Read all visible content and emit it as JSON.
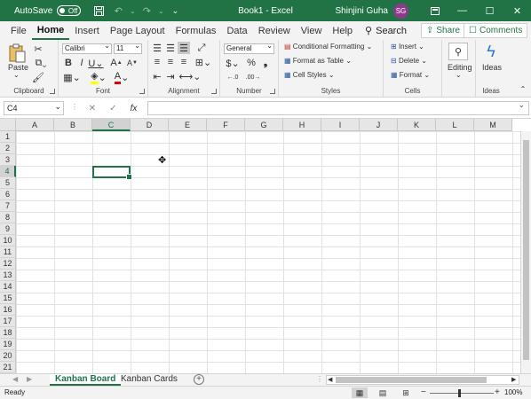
{
  "titlebar": {
    "autosave_label": "AutoSave",
    "autosave_state": "Off",
    "title": "Book1 - Excel",
    "user_name": "Shinjini Guha",
    "user_initials": "SG"
  },
  "menu": {
    "tabs": [
      "File",
      "Home",
      "Insert",
      "Page Layout",
      "Formulas",
      "Data",
      "Review",
      "View",
      "Help"
    ],
    "active": "Home",
    "search_label": "Search",
    "share_label": "Share",
    "comments_label": "Comments"
  },
  "ribbon": {
    "clipboard": {
      "label": "Clipboard",
      "paste": "Paste"
    },
    "font": {
      "label": "Font",
      "name": "Calibri",
      "size": "11"
    },
    "alignment": {
      "label": "Alignment"
    },
    "number": {
      "label": "Number",
      "format": "General"
    },
    "styles": {
      "label": "Styles",
      "items": [
        "Conditional Formatting",
        "Format as Table",
        "Cell Styles"
      ]
    },
    "cells": {
      "label": "Cells",
      "items": [
        "Insert",
        "Delete",
        "Format"
      ]
    },
    "editing": {
      "label": "Editing"
    },
    "ideas": {
      "label": "Ideas",
      "button": "Ideas"
    }
  },
  "formula_bar": {
    "name_box": "C4",
    "formula": ""
  },
  "grid": {
    "columns": [
      "A",
      "B",
      "C",
      "D",
      "E",
      "F",
      "G",
      "H",
      "I",
      "J",
      "K",
      "L",
      "M"
    ],
    "rows": [
      "1",
      "2",
      "3",
      "4",
      "5",
      "6",
      "7",
      "8",
      "9",
      "10",
      "11",
      "12",
      "13",
      "14",
      "15",
      "16",
      "17",
      "18",
      "19",
      "20",
      "21"
    ],
    "active_cell": "C4",
    "active_column": "C",
    "active_row": "4"
  },
  "sheets": {
    "tabs": [
      "Kanban Board",
      "Kanban Cards"
    ],
    "active": "Kanban Board"
  },
  "status": {
    "ready": "Ready",
    "zoom": "100%"
  },
  "colors": {
    "accent": "#217346",
    "avatar": "#8e3a8c"
  }
}
